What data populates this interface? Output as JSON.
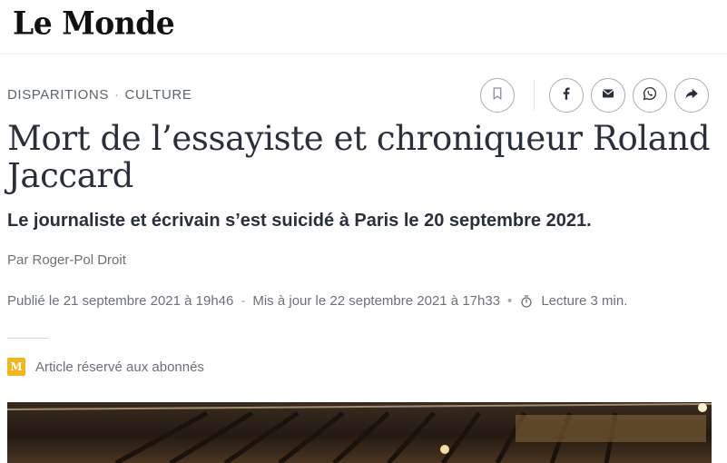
{
  "header": {
    "logo": "Le Monde"
  },
  "article": {
    "kicker": {
      "section1": "DISPARITIONS",
      "separator": "·",
      "section2": "CULTURE"
    },
    "title": "Mort de l’essayiste et chroniqueur Roland Jaccard",
    "subtitle": "Le journaliste et écrivain s’est suicidé à Paris le 20 septembre 2021.",
    "author": "Par Roger-Pol Droit",
    "published": "Publié le 21 septembre 2021 à 19h46",
    "updated": "Mis à jour le 22 septembre 2021 à 17h33",
    "reading_time": "Lecture 3 min.",
    "premium_badge": "M",
    "premium_label": "Article réservé aux abonnés"
  },
  "share": {
    "icons": [
      "bookmark-icon",
      "facebook-icon",
      "email-icon",
      "whatsapp-icon",
      "share-icon"
    ]
  },
  "colors": {
    "text": "#2a303b",
    "muted": "#6b717b",
    "premium": "#f2b71f"
  }
}
